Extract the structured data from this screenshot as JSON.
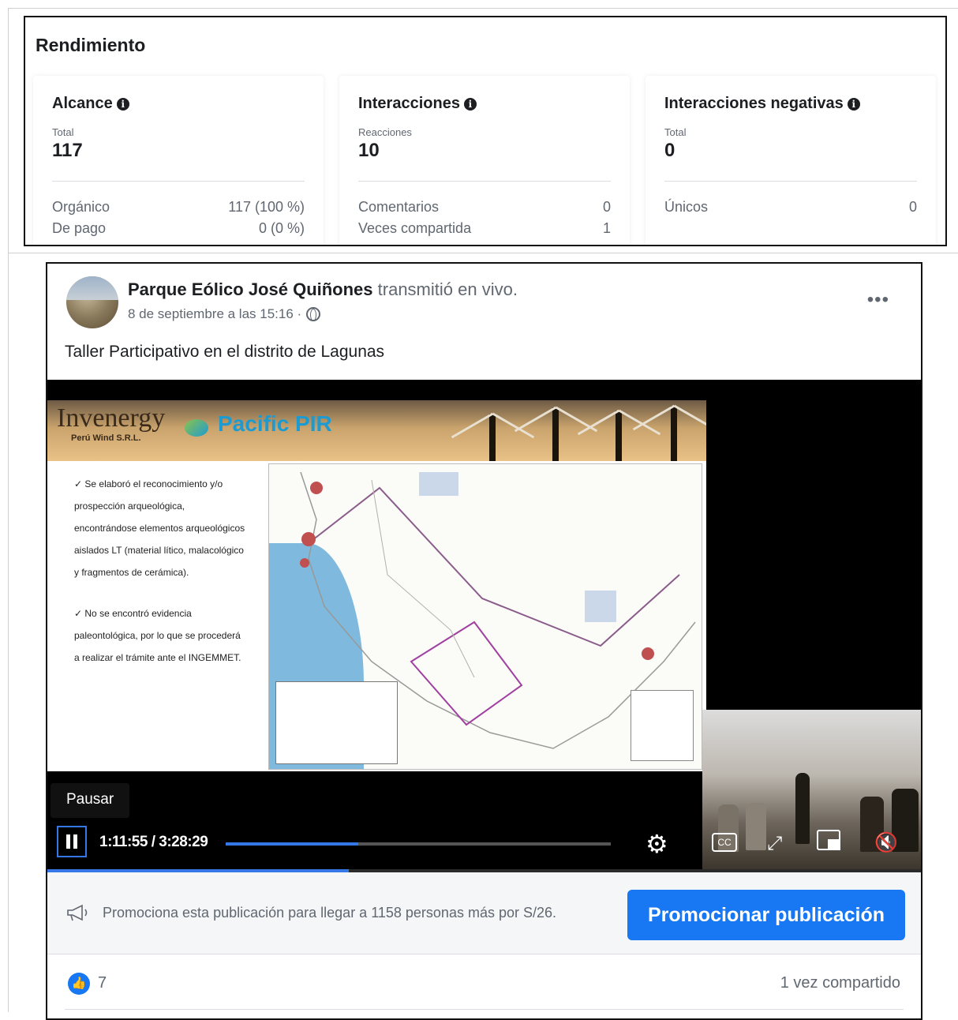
{
  "performance": {
    "title": "Rendimiento",
    "cards": [
      {
        "title": "Alcance",
        "subtitle": "Total",
        "value": "117",
        "rows": [
          {
            "label": "Orgánico",
            "value": "117 (100 %)"
          },
          {
            "label": "De pago",
            "value": "0 (0 %)"
          }
        ]
      },
      {
        "title": "Interacciones",
        "subtitle": "Reacciones",
        "value": "10",
        "rows": [
          {
            "label": "Comentarios",
            "value": "0"
          },
          {
            "label": "Veces compartida",
            "value": "1"
          }
        ]
      },
      {
        "title": "Interacciones negativas",
        "subtitle": "Total",
        "value": "0",
        "rows": [
          {
            "label": "Únicos",
            "value": "0"
          }
        ]
      }
    ]
  },
  "post": {
    "page_name": "Parque Eólico José Quiñones",
    "action": " transmitió en vivo.",
    "date": "8 de septiembre a las 15:16 ·",
    "more_icon": "more-horizontal-icon",
    "text": "Taller Participativo en el distrito de Lagunas",
    "video": {
      "slide": {
        "logo_primary": "Invenergy",
        "logo_primary_sub": "Perú Wind S.R.L.",
        "logo_secondary": "Pacific PIR",
        "bullets": [
          "✓  Se elaboró el reconocimiento y/o prospección arqueológica, encontrándose elementos arqueológicos aislados LT (material lítico, malacológico y fragmentos de cerámica).",
          "✓  No se encontró evidencia paleontológica, por lo que se procederá a realizar el trámite ante el INGEMMET."
        ]
      },
      "tooltip": "Pausar",
      "time_display": "1:11:55 / 3:28:29",
      "progress_fraction": 0.345,
      "buffered_fraction": 0.345,
      "icons": [
        "pause-icon",
        "gear-icon",
        "closed-captions-icon",
        "expand-icon",
        "picture-in-picture-icon",
        "volume-muted-icon"
      ]
    },
    "promotion": {
      "text": "Promociona esta publicación para llegar a 1158 personas más por S/26.",
      "button": "Promocionar publicación"
    },
    "stats": {
      "likes": "7",
      "shares": "1 vez compartido"
    }
  },
  "colors": {
    "accent": "#1877f2",
    "video_progress": "#3578e5"
  }
}
